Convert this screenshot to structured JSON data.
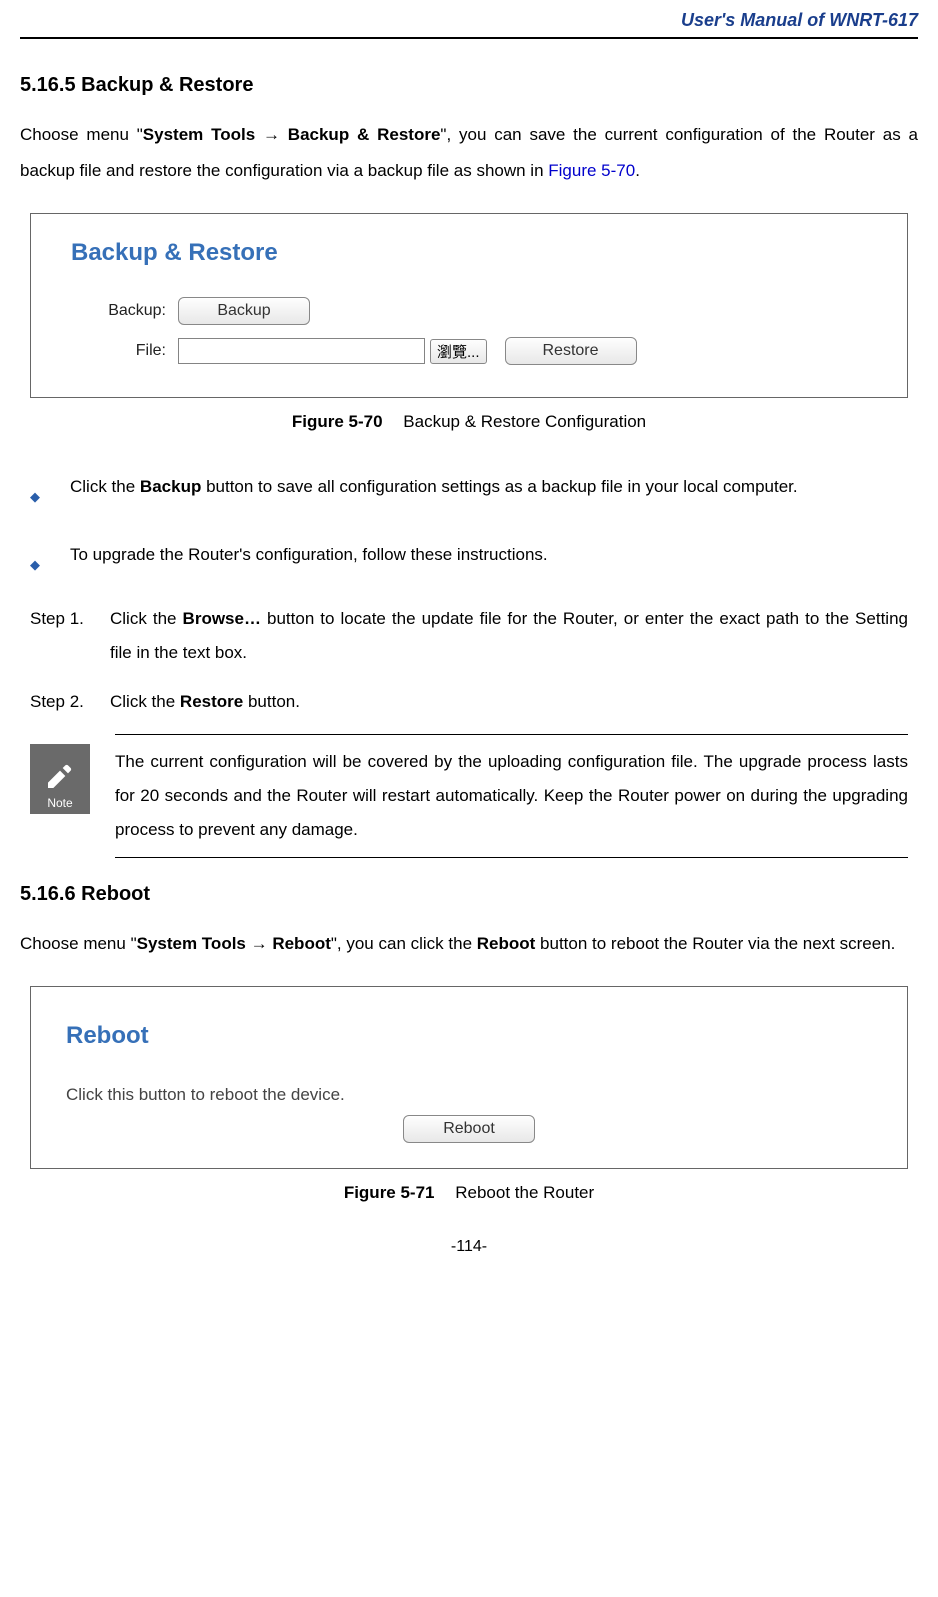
{
  "header": "User's Manual of WNRT-617",
  "section1": {
    "num": "5.16.5",
    "title": "Backup & Restore",
    "intro_pre": "Choose menu \"",
    "intro_menu": "System Tools → Backup & Restore",
    "intro_post": "\", you can save the current configuration of the Router as a backup file and restore the configuration via a backup file as shown in ",
    "intro_link": "Figure 5-70",
    "intro_end": "."
  },
  "figure1": {
    "panel_title": "Backup & Restore",
    "label_backup": "Backup:",
    "label_file": "File:",
    "btn_backup": "Backup",
    "btn_browse": "瀏覽...",
    "btn_restore": "Restore",
    "caption_bold": "Figure 5-70",
    "caption_rest": "Backup & Restore Configuration"
  },
  "bullets": {
    "b1_pre": "Click the ",
    "b1_bold": "Backup",
    "b1_post": " button to save all configuration settings as a backup file in your local computer.",
    "b2": "To upgrade the Router's configuration, follow these instructions."
  },
  "steps": {
    "s1_label": "Step 1.",
    "s1_pre": "Click the ",
    "s1_bold": "Browse…",
    "s1_post": " button to locate the update file for the Router, or enter the exact path to the Setting file in the text box.",
    "s2_label": "Step 2.",
    "s2_pre": "Click the ",
    "s2_bold": "Restore",
    "s2_post": " button."
  },
  "note": {
    "label": "Note",
    "text": "The current configuration will be covered by the uploading configuration file. The upgrade process lasts for 20 seconds and the Router will restart automatically. Keep the Router power on during the upgrading process to prevent any damage."
  },
  "section2": {
    "num": "5.16.6",
    "title": "Reboot",
    "intro_pre": "Choose menu \"",
    "intro_menu": "System Tools → Reboot",
    "intro_mid": "\", you can click the ",
    "intro_bold2": "Reboot",
    "intro_post": " button to reboot the Router via the next screen."
  },
  "figure2": {
    "panel_title": "Reboot",
    "hint": "Click this button to reboot the device.",
    "btn_reboot": "Reboot",
    "caption_bold": "Figure 5-71",
    "caption_rest": "Reboot the Router"
  },
  "page_num": "-114-"
}
